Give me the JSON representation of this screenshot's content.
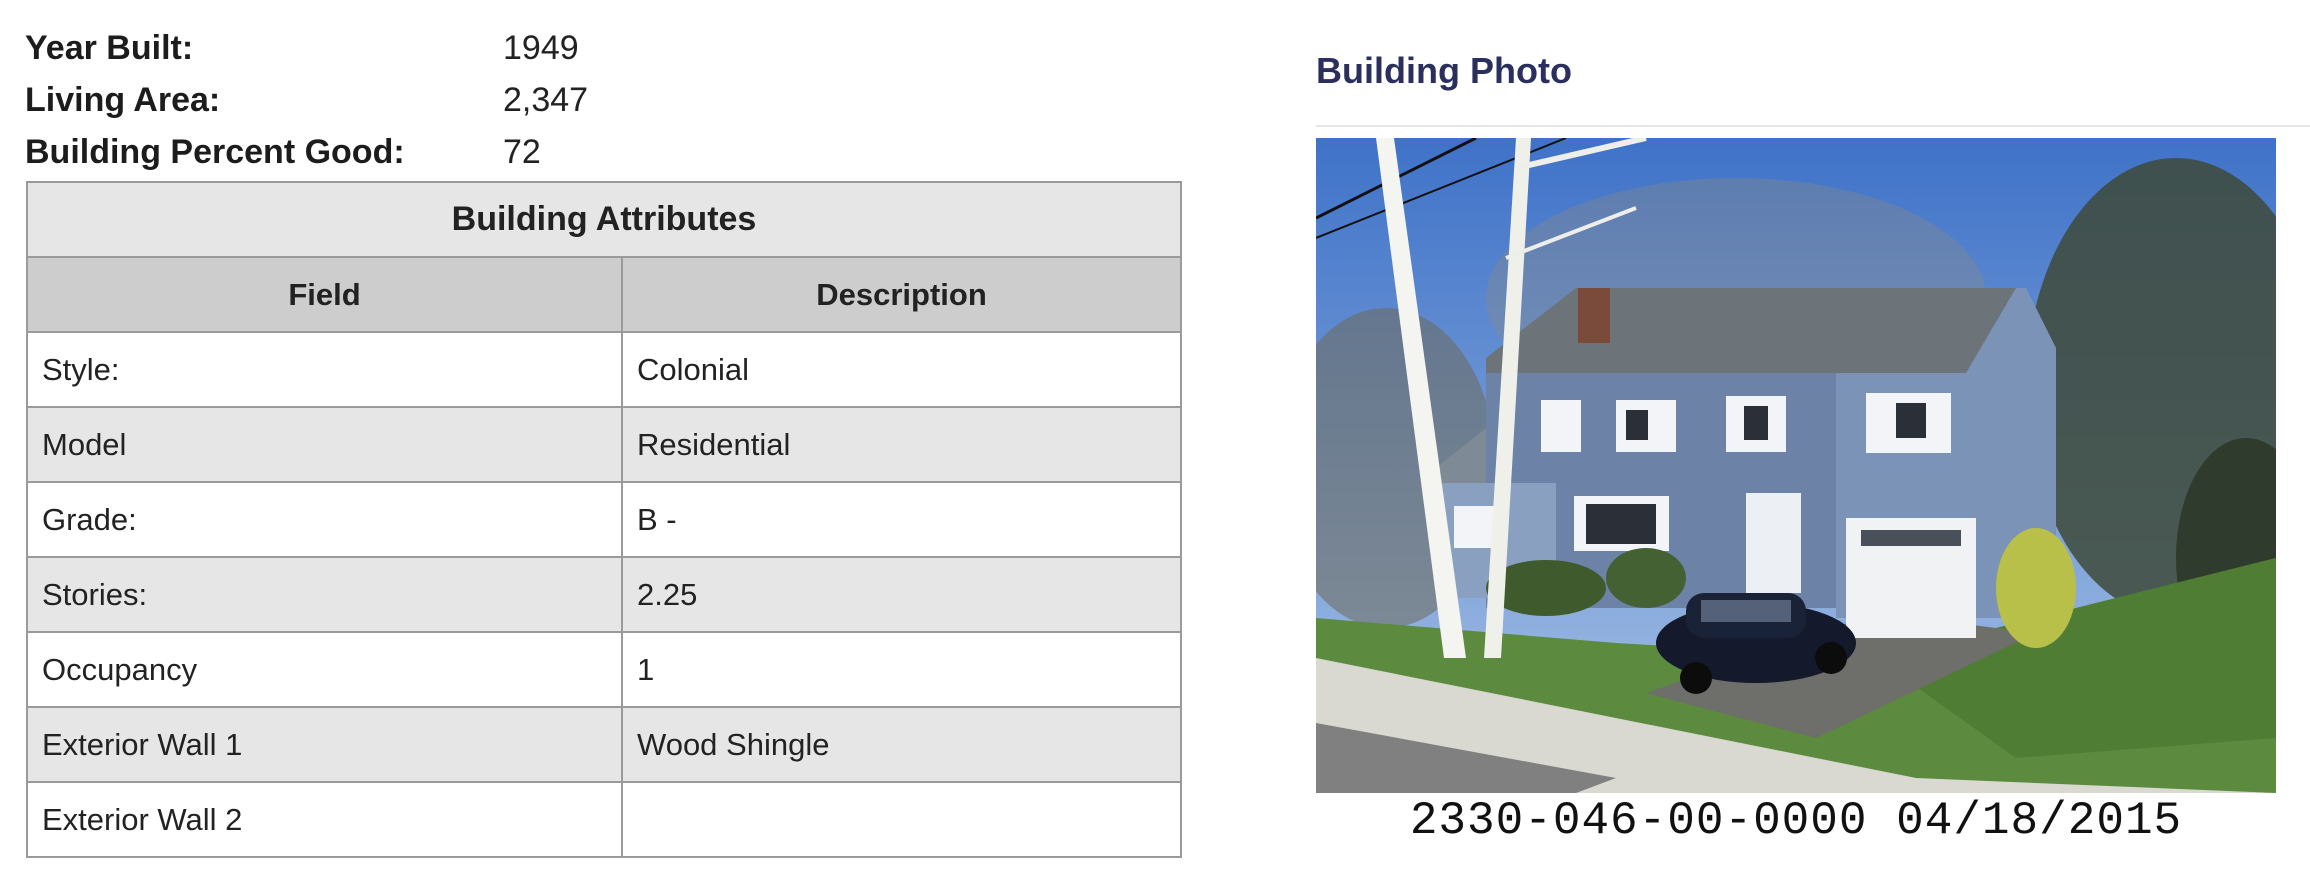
{
  "summary": [
    {
      "label": "Year Built:",
      "value": "1949"
    },
    {
      "label": "Living Area:",
      "value": "2,347"
    },
    {
      "label": "Building Percent Good:",
      "value": "72"
    }
  ],
  "attributes": {
    "caption": "Building Attributes",
    "headers": {
      "field": "Field",
      "description": "Description"
    },
    "rows": [
      {
        "field": "Style:",
        "description": "Colonial"
      },
      {
        "field": "Model",
        "description": "Residential"
      },
      {
        "field": "Grade:",
        "description": "B -"
      },
      {
        "field": "Stories:",
        "description": "2.25"
      },
      {
        "field": "Occupancy",
        "description": "1"
      },
      {
        "field": "Exterior Wall 1",
        "description": "Wood Shingle"
      },
      {
        "field": "Exterior Wall 2",
        "description": ""
      }
    ]
  },
  "photo": {
    "title": "Building Photo",
    "caption": "2330-046-00-0000  04/18/2015"
  }
}
